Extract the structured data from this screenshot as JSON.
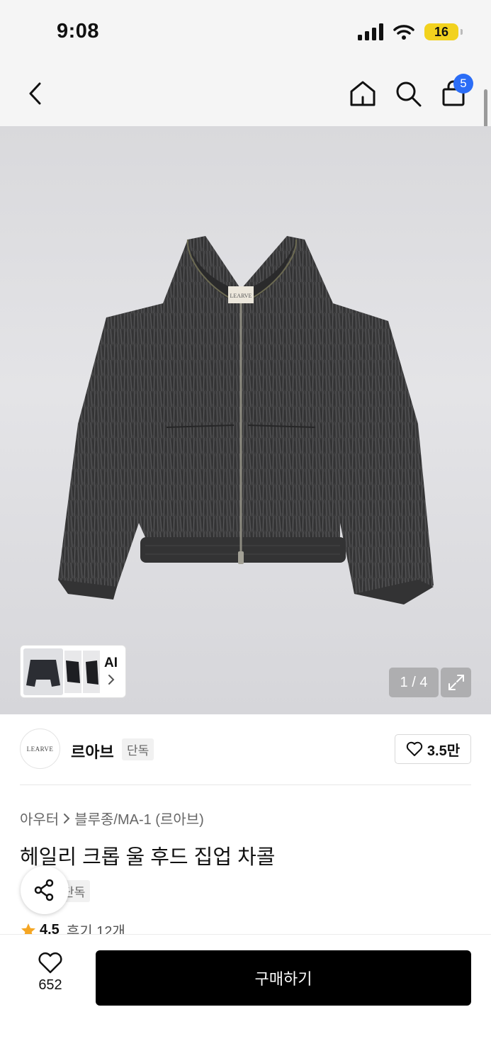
{
  "status": {
    "time": "9:08",
    "battery": "16"
  },
  "nav": {
    "cart_count": "5"
  },
  "gallery": {
    "ai_label": "AI",
    "page_indicator": "1 / 4"
  },
  "jacket_label_text": "LEARVE",
  "brand": {
    "logo_text": "LEARVE",
    "name": "르아브",
    "tag": "단독",
    "likes": "3.5만"
  },
  "breadcrumb": {
    "category": "아우터",
    "subcategory": "블루종/MA-1 (르아브)"
  },
  "product": {
    "title": "헤일리 크롭 울 후드 집업 차콜",
    "tag": "단독",
    "rating": "4.5",
    "reviews": "후기 12개"
  },
  "bottom": {
    "wish_count": "652",
    "buy_label": "구매하기"
  },
  "colors": {
    "accent_blue": "#2b6df6",
    "battery_yellow": "#f2d21e",
    "star_orange": "#f5a623",
    "button_black": "#000000"
  }
}
